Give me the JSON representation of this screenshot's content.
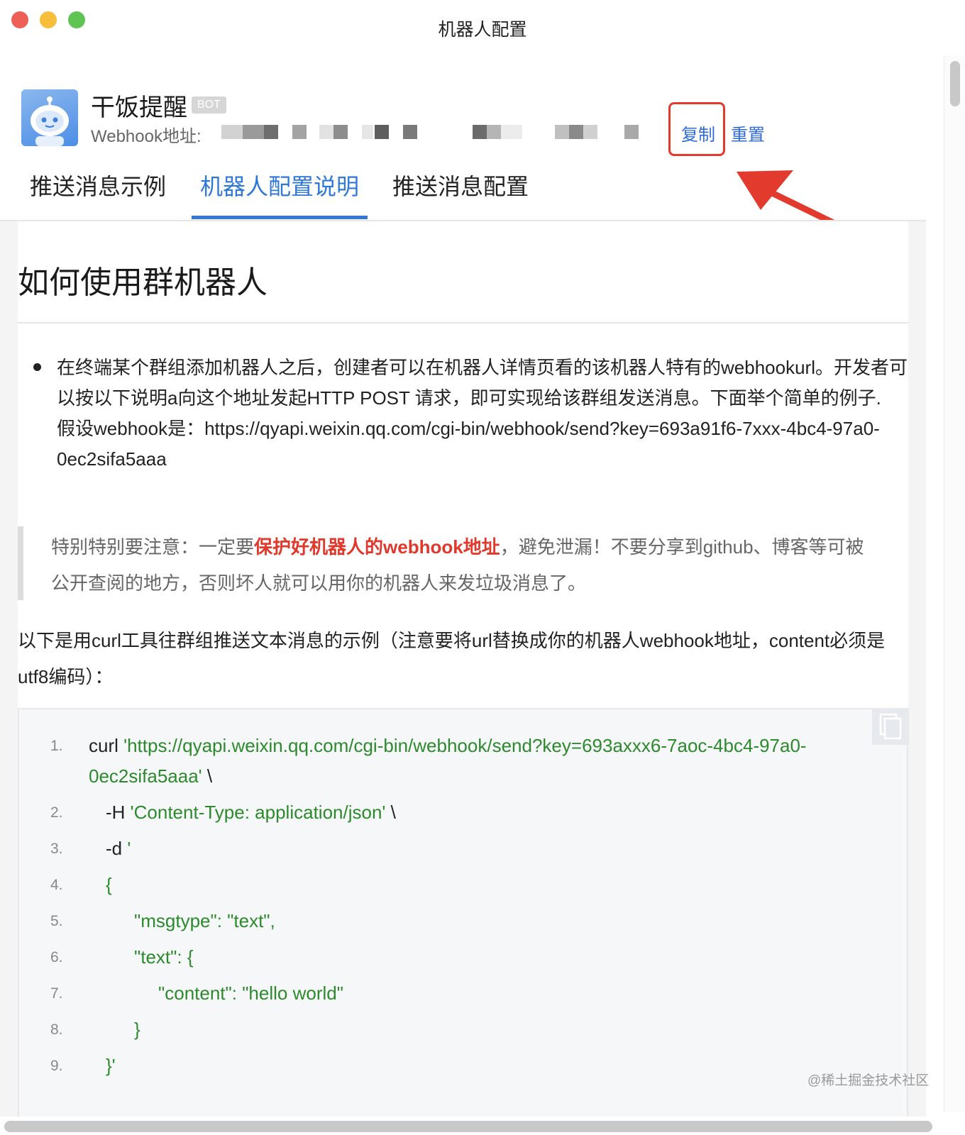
{
  "window": {
    "title": "机器人配置"
  },
  "bot": {
    "name": "干饭提醒",
    "badge": "BOT",
    "webhook_label": "Webhook地址:",
    "copy_label": "复制",
    "reset_label": "重置"
  },
  "tabs": [
    {
      "label": "推送消息示例",
      "active": false
    },
    {
      "label": "机器人配置说明",
      "active": true
    },
    {
      "label": "推送消息配置",
      "active": false
    }
  ],
  "doc": {
    "title": "如何使用群机器人",
    "bullet_text": "在终端某个群组添加机器人之后，创建者可以在机器人详情页看的该机器人特有的webhookurl。开发者可以按以下说明a向这个地址发起HTTP POST 请求，即可实现给该群组发送消息。下面举个简单的例子.",
    "bullet_example": "假设webhook是：https://qyapi.weixin.qq.com/cgi-bin/webhook/send?key=693a91f6-7xxx-4bc4-97a0-0ec2sifa5aaa",
    "notice_prefix": "特别特别要注意：一定要",
    "notice_highlight": "保护好机器人的webhook地址",
    "notice_suffix": "，避免泄漏！不要分享到github、博客等可被公开查阅的地方，否则坏人就可以用你的机器人来发垃圾消息了。",
    "intro": "以下是用curl工具往群组推送文本消息的示例（注意要将url替换成你的机器人webhook地址，content必须是utf8编码）：",
    "code_lines": [
      {
        "n": "1.",
        "plain": "curl ",
        "str": "'https://qyapi.weixin.qq.com/cgi-bin/webhook/send?key=693axxx6-7aoc-4bc4-97a0-",
        "str2": "0ec2sifa5aaa'",
        "tail": " \\"
      },
      {
        "n": "2.",
        "plain": "-H ",
        "str": "'Content-Type: application/json'",
        "tail": " \\"
      },
      {
        "n": "3.",
        "plain": "-d ",
        "str": "'"
      },
      {
        "n": "4.",
        "str": "{"
      },
      {
        "n": "5.",
        "str": "\"msgtype\": \"text\","
      },
      {
        "n": "6.",
        "str": "\"text\": {"
      },
      {
        "n": "7.",
        "str": "\"content\": \"hello world\""
      },
      {
        "n": "8.",
        "str": "}"
      },
      {
        "n": "9.",
        "str": "}'"
      }
    ]
  },
  "watermark": "@稀土掘金技术社区",
  "colors": {
    "accent": "#2f78d6",
    "highlight_red": "#e0382b",
    "code_string": "#2c8a2c",
    "annotation_red": "#e23b2e"
  }
}
